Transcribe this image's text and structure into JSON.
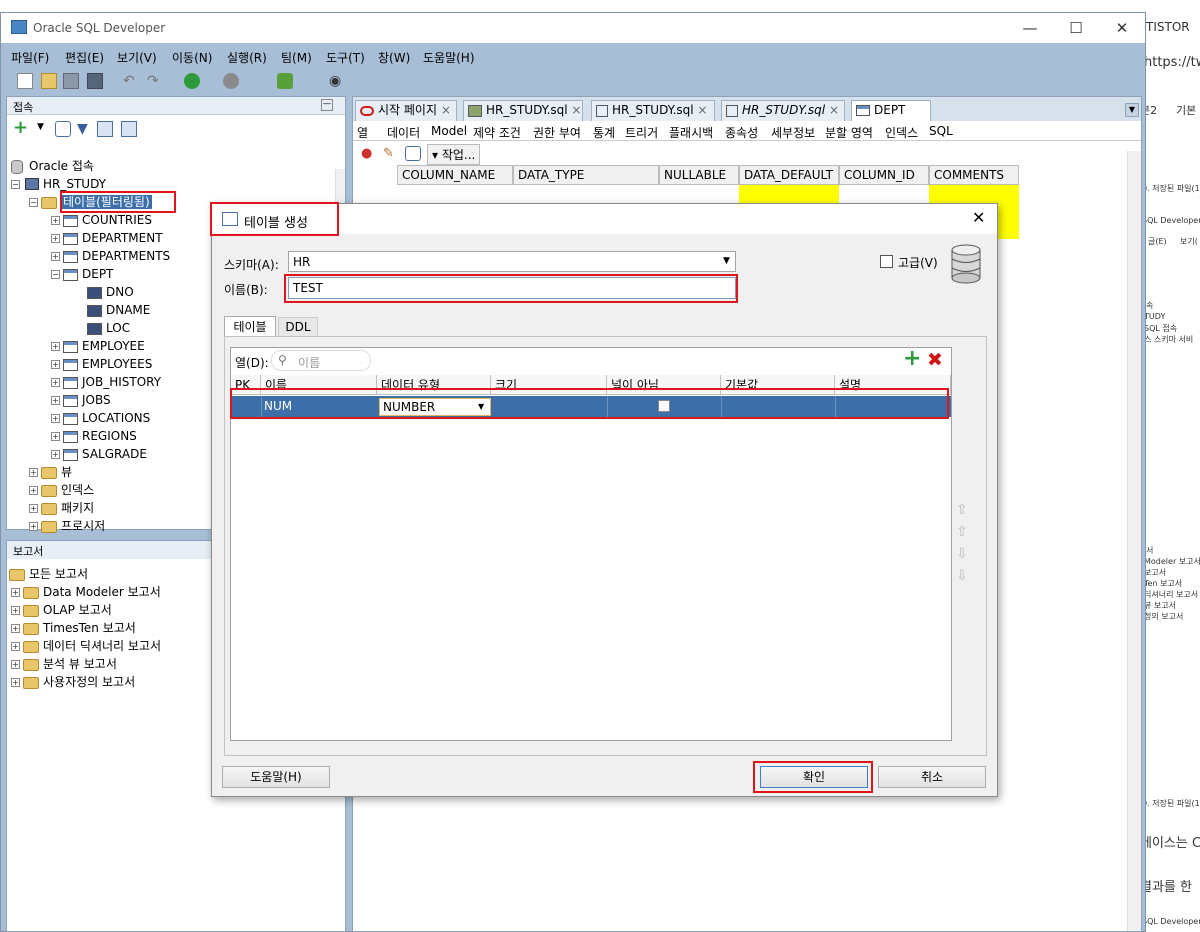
{
  "app": {
    "title": "Oracle SQL Developer",
    "menu": [
      "파일(F)",
      "편집(E)",
      "보기(V)",
      "이동(N)",
      "실행(R)",
      "팀(M)",
      "도구(T)",
      "창(W)",
      "도움말(H)"
    ]
  },
  "connections": {
    "header": "접속",
    "root": "Oracle 접속",
    "connection": "HR_STUDY",
    "tables_node": "테이블(필터링됨)",
    "tables": [
      "COUNTRIES",
      "DEPARTMENT",
      "DEPARTMENTS",
      "DEPT",
      "EMPLOYEE",
      "EMPLOYEES",
      "JOB_HISTORY",
      "JOBS",
      "LOCATIONS",
      "REGIONS",
      "SALGRADE"
    ],
    "dept_columns": [
      "DNO",
      "DNAME",
      "LOC"
    ],
    "other_nodes": [
      "뷰",
      "인덱스",
      "패키지",
      "프로시저"
    ]
  },
  "reports": {
    "header": "보고서",
    "items": [
      "모든 보고서",
      "Data Modeler 보고서",
      "OLAP 보고서",
      "TimesTen 보고서",
      "데이터 딕셔너리 보고서",
      "분석 뷰 보고서",
      "사용자정의 보고서"
    ]
  },
  "editor": {
    "tabs": [
      "시작 페이지",
      "HR_STUDY.sql",
      "HR_STUDY.sql",
      "HR_STUDY.sql",
      "DEPT"
    ],
    "subtabs": [
      "열",
      "데이터",
      "Model",
      "제약 조건",
      "권한 부여",
      "통계",
      "트리거",
      "플래시백",
      "종속성",
      "세부정보",
      "분할 영역",
      "인덱스",
      "SQL"
    ],
    "action_label": "▾ 작업...",
    "grid_headers": [
      "COLUMN_NAME",
      "DATA_TYPE",
      "NULLABLE",
      "DATA_DEFAULT",
      "COLUMN_ID",
      "COMMENTS"
    ]
  },
  "dialog": {
    "title": "테이블 생성",
    "schema_label": "스키마(A):",
    "schema_value": "HR",
    "advanced_label": "고급(V)",
    "name_label": "이름(B):",
    "name_value": "TEST",
    "tabs": [
      "테이블",
      "DDL"
    ],
    "columns_label": "열(D):",
    "search_placeholder": "이름",
    "table_headers": [
      "PK",
      "이름",
      "데이터 유형",
      "크기",
      "널이 아님",
      "기본값",
      "설명"
    ],
    "row": {
      "name": "NUM",
      "type": "NUMBER"
    },
    "help_button": "도움말(H)",
    "ok_button": "확인",
    "cancel_button": "취소"
  },
  "browser_strip": {
    "texts": [
      "TISTOR",
      "https://tw",
      "본2",
      "기본",
      "0. 저장된 파일(1",
      "SQL Developer : C",
      "글(E)",
      "보기(",
      "속",
      "TUDY",
      "SQL 접속",
      "스 스키마 서비",
      "서",
      "Modeler 보고서",
      "보고서",
      "Ten 보고서",
      "딕셔너리 보고서",
      "뷰 보고서",
      "정의 보고서",
      "0. 저장된 파일(1",
      "베이스는 C",
      "결과를 한",
      "SQL Developer : 테"
    ]
  },
  "colors": {
    "accent": "#e0151b",
    "selection": "#3c6ea8",
    "highlight": "#ffff00"
  }
}
